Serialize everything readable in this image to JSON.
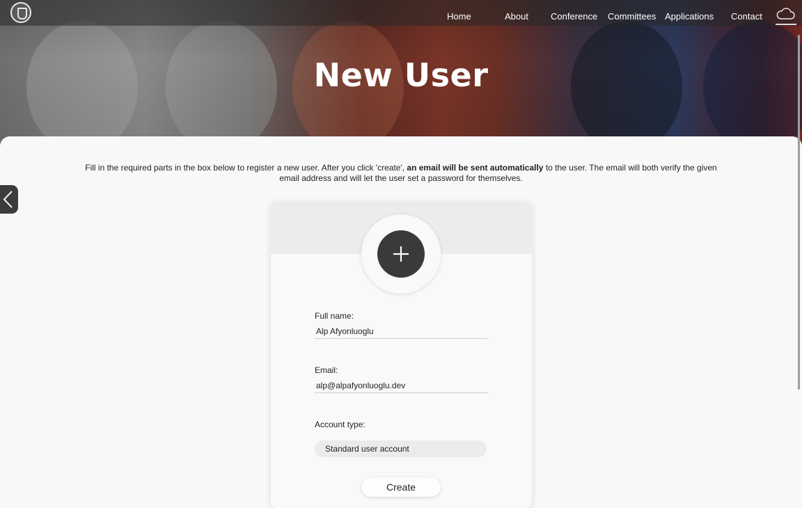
{
  "nav": {
    "items": [
      "Home",
      "About",
      "Conference",
      "Committees",
      "Applications",
      "Contact"
    ],
    "logo_icon": "crest-logo-icon",
    "cloud_icon": "cloud-icon"
  },
  "page": {
    "title": "New User",
    "intro_before": "Fill in the required parts in the box below to register a new user. After you click 'create', ",
    "intro_bold": "an email will be sent automatically",
    "intro_after": " to the user. The email will both verify the given email address and will let the user set a password for themselves."
  },
  "form": {
    "name_label": "Full name:",
    "name_value": "Alp Afyonluoglu",
    "email_label": "Email:",
    "email_value": "alp@alpafyonluoglu.dev",
    "type_label": "Account type:",
    "type_value": "Standard user account",
    "create_label": "Create"
  },
  "colors": {
    "accent_dark": "#3a3a3a",
    "panel_bg": "#f8f8f8",
    "header_bg": "#ececec"
  }
}
